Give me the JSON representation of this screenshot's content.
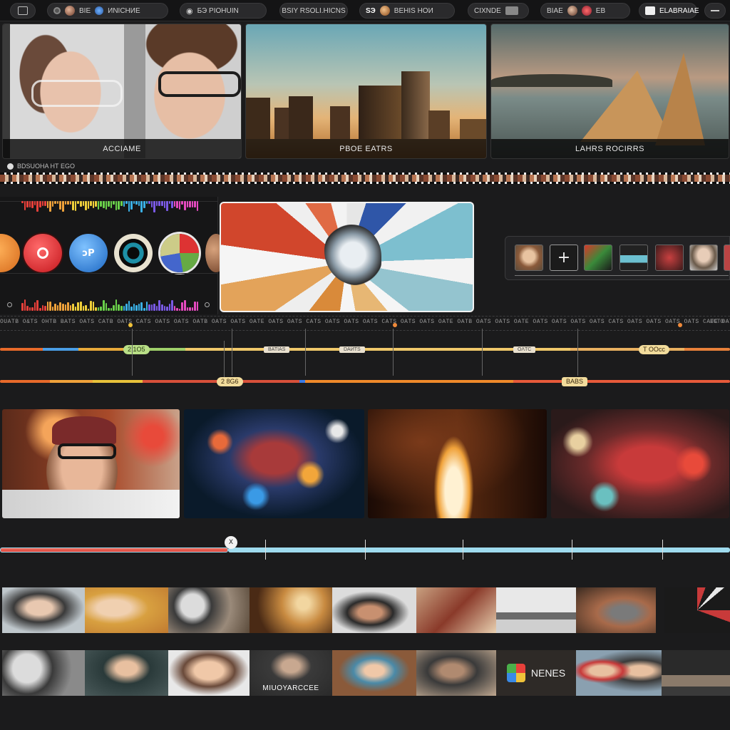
{
  "toolbar": {
    "items": [
      {
        "label": ""
      },
      {
        "label": "BIE"
      },
      {
        "label": "ИNICHИE"
      },
      {
        "label": "БЭ PIOHUIN"
      },
      {
        "label": "BSIY RSOLI.HICNS"
      },
      {
        "label": "ЅЭ"
      },
      {
        "label": "BEHIS HOИ"
      },
      {
        "label": "CIXNDE"
      },
      {
        "label": "BIAE"
      },
      {
        "label": "ЕВ"
      },
      {
        "label": "ELABRAIAE"
      }
    ]
  },
  "previews": [
    {
      "caption": "ACCIAME"
    },
    {
      "caption": "PBOE EATRS"
    },
    {
      "caption": "LAHRS ROCIRRS"
    }
  ],
  "filmstrip": {
    "label": "BDSUOHA HТ EGO"
  },
  "ruler": {
    "ticks": "OUATB O&TS OHTB BATS OATS CATB OATS CATS OATS OATS OATB OATS OATS OATE OATS OATS CATS OATS OATS OATS CATS OATS OATS OATE OATB OATS OATS OATE OATS OATS OATS OATS CATS OATS OATS OATS OATS CATE OATS OATE",
    "end_label": "ECTO"
  },
  "tracks": {
    "tag_a": "2 1O5",
    "tag_b": "T OOcc",
    "tag_c": "2 8G6",
    "tag_d": "BABS",
    "small_a": "BATIAS",
    "small_b": "DAИTS",
    "small_c": "ΟΛTС"
  },
  "playhead": {
    "label": "X"
  },
  "bottom_row": [
    {
      "text": ""
    },
    {
      "text": ""
    },
    {
      "text": ""
    },
    {
      "text": "MIUOYARCCEE"
    },
    {
      "text": ""
    },
    {
      "text": ""
    },
    {
      "text": "NENES"
    },
    {
      "text": ""
    },
    {
      "text": ""
    }
  ],
  "colors": {
    "background": "#1b1b1c",
    "accent_orange": "#e8703a",
    "accent_blue": "#9fdbee",
    "accent_red": "#f05a4f",
    "tag_yellow": "#f2dc9c"
  }
}
